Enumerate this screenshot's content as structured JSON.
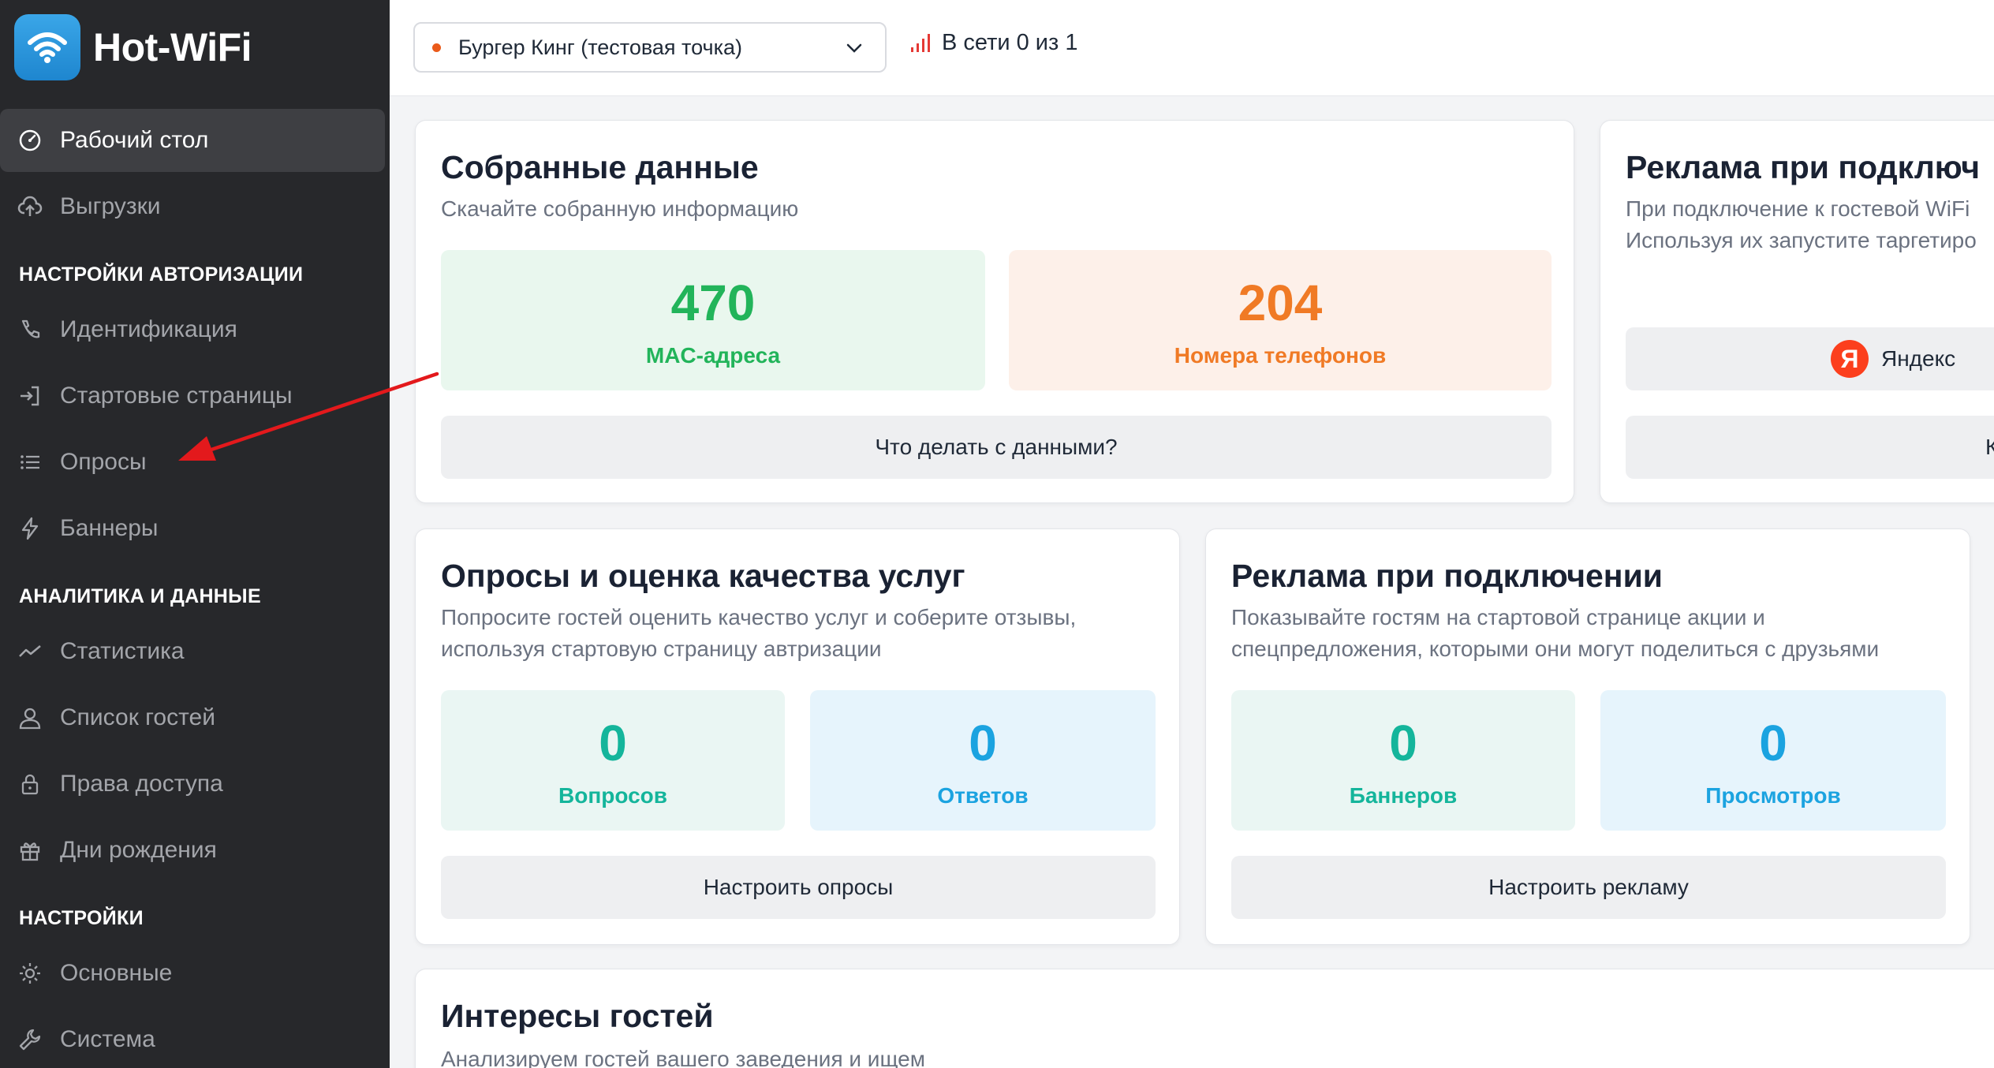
{
  "app": {
    "name": "Hot-WiFi"
  },
  "sidebar": {
    "items": [
      {
        "label": "Рабочий стол",
        "icon": "dashboard-icon"
      },
      {
        "label": "Выгрузки",
        "icon": "cloud-upload-icon"
      },
      {
        "label": "Идентификация",
        "icon": "phone-icon"
      },
      {
        "label": "Стартовые страницы",
        "icon": "login-icon"
      },
      {
        "label": "Опросы",
        "icon": "list-icon"
      },
      {
        "label": "Баннеры",
        "icon": "lightning-icon"
      },
      {
        "label": "Статистика",
        "icon": "chart-line-icon"
      },
      {
        "label": "Список гостей",
        "icon": "user-icon"
      },
      {
        "label": "Права доступа",
        "icon": "lock-icon"
      },
      {
        "label": "Дни рождения",
        "icon": "gift-icon"
      },
      {
        "label": "Основные",
        "icon": "gear-icon"
      },
      {
        "label": "Система",
        "icon": "wrench-icon"
      }
    ],
    "sections": [
      "НАСТРОЙКИ АВТОРИЗАЦИИ",
      "АНАЛИТИКА И ДАННЫЕ",
      "НАСТРОЙКИ"
    ]
  },
  "topbar": {
    "location": "Бургер Кинг (тестовая точка)",
    "online_status": "В сети 0 из 1"
  },
  "cards": {
    "collected": {
      "title": "Собранные данные",
      "subtitle": "Скачайте собранную информацию",
      "stat1": {
        "value": "470",
        "label": "MAC-адреса"
      },
      "stat2": {
        "value": "204",
        "label": "Номера телефонов"
      },
      "button": "Что делать с данными?"
    },
    "ads_top": {
      "title": "Реклама при подключ",
      "subtitle1": "При подключение к гостевой WiFi",
      "subtitle2": "Используя их запустите таргетиро",
      "button1": "Яндекс",
      "button2": "К"
    },
    "surveys": {
      "title": "Опросы и оценка качества услуг",
      "subtitle1": "Попросите гостей оценить качество услуг и соберите отзывы,",
      "subtitle2": "используя стартовую страницу автризации",
      "stat1": {
        "value": "0",
        "label": "Вопросов"
      },
      "stat2": {
        "value": "0",
        "label": "Ответов"
      },
      "button": "Настроить опросы"
    },
    "ads": {
      "title": "Реклама при подключении",
      "subtitle1": "Показывайте гостям на стартовой странице акции и",
      "subtitle2": "спецпредложения, которыми они могут поделиться с друзьями",
      "stat1": {
        "value": "0",
        "label": "Баннеров"
      },
      "stat2": {
        "value": "0",
        "label": "Просмотров"
      },
      "button": "Настроить рекламу"
    },
    "interests": {
      "title": "Интересы гостей",
      "subtitle": "Анализируем гостей вашего заведения и ищем"
    }
  },
  "colors": {
    "sidebar_bg": "#27282b",
    "accent_blue": "#1ba3e0",
    "green": "#22b45a",
    "orange": "#f07a25",
    "teal": "#14b59b",
    "arrow": "#e3191c"
  }
}
